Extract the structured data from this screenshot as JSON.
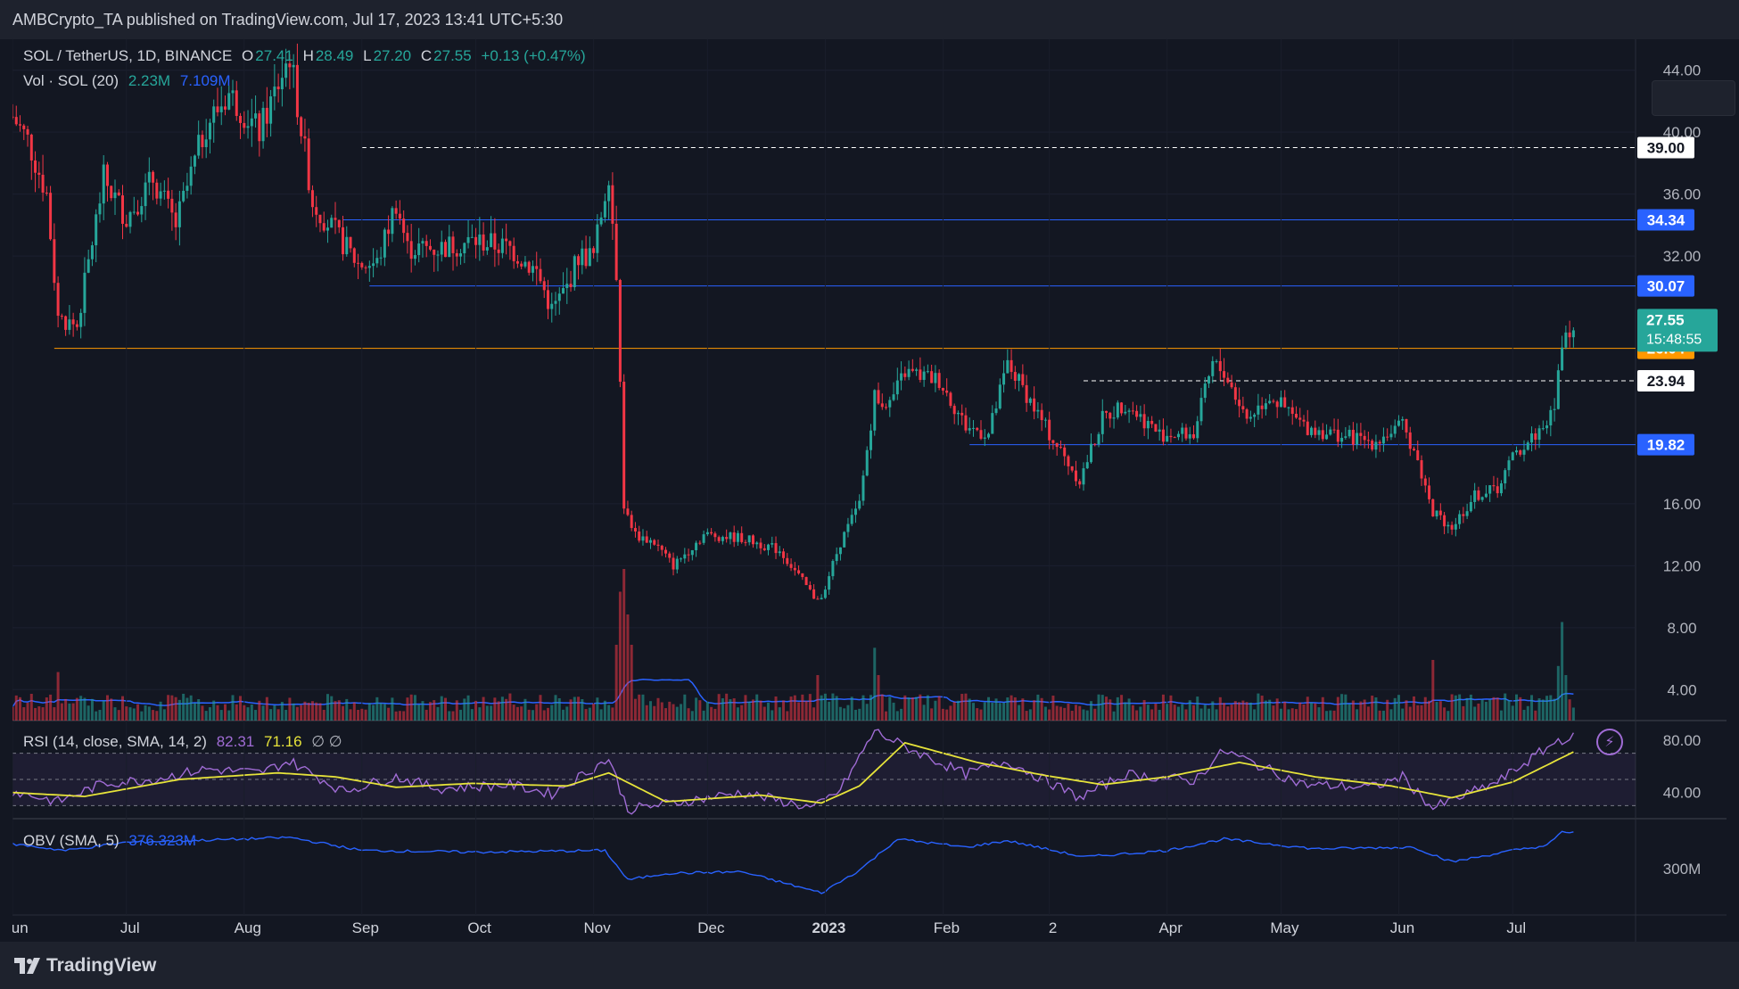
{
  "header": {
    "publisher": "AMBCrypto_TA published on TradingView.com, Jul 17, 2023 13:41 UTC+5:30"
  },
  "legend": {
    "symbol": "SOL / TetherUS, 1D, BINANCE",
    "o_key": "O",
    "o": "27.41",
    "h_key": "H",
    "h": "28.49",
    "l_key": "L",
    "l": "27.20",
    "c_key": "C",
    "c": "27.55",
    "change": "+0.13 (+0.47%)",
    "vol_label": "Vol · SOL (20)",
    "vol_value": "2.23M",
    "vol_ma": "7.109M",
    "rsi_label": "RSI (14, close, SMA, 14, 2)",
    "rsi_value": "82.31",
    "rsi_ma": "71.16",
    "rsi_extra": "∅ ∅",
    "obv_label": "OBV (SMA, 5)",
    "obv_value": "376.323M"
  },
  "footer": {
    "brand": "TradingView"
  },
  "colors": {
    "up": "#26a69a",
    "down": "#f23645",
    "blue": "#2962ff",
    "orange": "#ff9800",
    "rsi": "#a06cd5",
    "rsi_ma": "#e6e33a",
    "obv": "#2962ff",
    "bg": "#131722"
  },
  "chart_data": [
    {
      "type": "candlestick",
      "title": "SOL / TetherUS, 1D, BINANCE",
      "ylim": [
        2,
        46
      ],
      "y_ticks": [
        "4.00",
        "8.00",
        "12.00",
        "16.00",
        "32.00",
        "36.00",
        "40.00",
        "44.00"
      ],
      "x_ticks": [
        "Jun",
        "Jul",
        "Aug",
        "Sep",
        "Oct",
        "Nov",
        "Dec",
        "2023",
        "Feb",
        "2",
        "Apr",
        "May",
        "Jun",
        "Jul"
      ],
      "x_range": [
        "2022-06-01",
        "2023-07-31"
      ],
      "close_points": [
        [
          "2022-06-01",
          41.0
        ],
        [
          "2022-06-05",
          39.5
        ],
        [
          "2022-06-10",
          36.0
        ],
        [
          "2022-06-13",
          28.0
        ],
        [
          "2022-06-18",
          27.5
        ],
        [
          "2022-06-25",
          37.0
        ],
        [
          "2022-07-01",
          34.5
        ],
        [
          "2022-07-08",
          37.0
        ],
        [
          "2022-07-14",
          34.0
        ],
        [
          "2022-07-22",
          40.5
        ],
        [
          "2022-07-28",
          42.5
        ],
        [
          "2022-08-05",
          40.0
        ],
        [
          "2022-08-13",
          45.0
        ],
        [
          "2022-08-19",
          35.5
        ],
        [
          "2022-08-25",
          33.5
        ],
        [
          "2022-08-31",
          31.5
        ],
        [
          "2022-09-05",
          31.5
        ],
        [
          "2022-09-10",
          35.5
        ],
        [
          "2022-09-13",
          32.5
        ],
        [
          "2022-09-21",
          32.5
        ],
        [
          "2022-10-01",
          33.0
        ],
        [
          "2022-10-10",
          32.5
        ],
        [
          "2022-10-17",
          31.0
        ],
        [
          "2022-10-21",
          28.5
        ],
        [
          "2022-10-25",
          30.0
        ],
        [
          "2022-10-28",
          32.0
        ],
        [
          "2022-11-01",
          32.0
        ],
        [
          "2022-11-05",
          37.5
        ],
        [
          "2022-11-07",
          31.0
        ],
        [
          "2022-11-09",
          16.0
        ],
        [
          "2022-11-12",
          14.0
        ],
        [
          "2022-11-17",
          13.5
        ],
        [
          "2022-11-22",
          12.0
        ],
        [
          "2022-11-30",
          14.0
        ],
        [
          "2022-12-10",
          13.8
        ],
        [
          "2022-12-20",
          13.0
        ],
        [
          "2022-12-29",
          10.0
        ],
        [
          "2022-12-31",
          10.0
        ],
        [
          "2023-01-05",
          13.5
        ],
        [
          "2023-01-10",
          16.0
        ],
        [
          "2023-01-14",
          23.0
        ],
        [
          "2023-01-18",
          22.5
        ],
        [
          "2023-01-22",
          24.5
        ],
        [
          "2023-01-31",
          24.0
        ],
        [
          "2023-02-07",
          21.0
        ],
        [
          "2023-02-13",
          20.5
        ],
        [
          "2023-02-18",
          25.0
        ],
        [
          "2023-02-22",
          23.5
        ],
        [
          "2023-03-01",
          20.5
        ],
        [
          "2023-03-09",
          17.5
        ],
        [
          "2023-03-15",
          21.5
        ],
        [
          "2023-03-21",
          22.5
        ],
        [
          "2023-03-30",
          20.5
        ],
        [
          "2023-04-08",
          20.5
        ],
        [
          "2023-04-13",
          25.0
        ],
        [
          "2023-04-16",
          24.5
        ],
        [
          "2023-04-22",
          21.5
        ],
        [
          "2023-04-28",
          23.0
        ],
        [
          "2023-05-07",
          21.0
        ],
        [
          "2023-05-15",
          20.5
        ],
        [
          "2023-05-25",
          20.0
        ],
        [
          "2023-06-02",
          21.0
        ],
        [
          "2023-06-05",
          19.5
        ],
        [
          "2023-06-10",
          15.5
        ],
        [
          "2023-06-15",
          14.5
        ],
        [
          "2023-06-21",
          16.5
        ],
        [
          "2023-06-27",
          17.0
        ],
        [
          "2023-07-01",
          19.0
        ],
        [
          "2023-07-09",
          21.0
        ],
        [
          "2023-07-12",
          22.0
        ],
        [
          "2023-07-13",
          25.0
        ],
        [
          "2023-07-14",
          26.5
        ],
        [
          "2023-07-15",
          27.3
        ],
        [
          "2023-07-17",
          27.55
        ]
      ],
      "levels": [
        {
          "label": "39.00",
          "value": 39.0,
          "style": "dashed",
          "color": "#ffffff",
          "from": "2022-09-01"
        },
        {
          "label": "34.34",
          "value": 34.34,
          "style": "solid",
          "color": "#2962ff",
          "from": "2022-08-27"
        },
        {
          "label": "30.07",
          "value": 30.07,
          "style": "solid",
          "color": "#2962ff",
          "from": "2022-09-03"
        },
        {
          "label": "26.04",
          "value": 26.04,
          "style": "solid",
          "color": "#ff9800",
          "from": "2022-06-12"
        },
        {
          "label": "23.94",
          "value": 23.94,
          "style": "dashed",
          "color": "#ffffff",
          "from": "2023-03-10"
        },
        {
          "label": "19.82",
          "value": 19.82,
          "style": "solid",
          "color": "#2962ff",
          "from": "2023-02-08"
        }
      ],
      "last_price": {
        "value": 27.55,
        "label": "27.55",
        "countdown": "15:48:55"
      }
    },
    {
      "type": "bar",
      "title": "Vol · SOL (20)",
      "value": "2.23M",
      "ma": "7.109M",
      "spikes": [
        [
          "2022-06-13",
          3.2
        ],
        [
          "2022-11-07",
          5.0
        ],
        [
          "2022-11-08",
          8.5
        ],
        [
          "2022-11-09",
          10.0
        ],
        [
          "2022-11-10",
          7.0
        ],
        [
          "2022-11-11",
          5.0
        ],
        [
          "2022-12-30",
          3.0
        ],
        [
          "2023-01-14",
          4.8
        ],
        [
          "2023-01-15",
          3.0
        ],
        [
          "2023-06-10",
          4.0
        ],
        [
          "2023-07-13",
          3.6
        ],
        [
          "2023-07-14",
          6.5
        ],
        [
          "2023-07-15",
          3.0
        ]
      ]
    },
    {
      "type": "line",
      "title": "RSI (14, close, SMA, 14, 2)",
      "value": "82.31",
      "ma": "71.16",
      "ylim": [
        20,
        95
      ],
      "y_ticks": [
        "80.00",
        "40.00"
      ],
      "band": [
        30,
        70
      ],
      "points": [
        [
          "2022-06-01",
          41
        ],
        [
          "2022-06-13",
          33
        ],
        [
          "2022-06-25",
          47
        ],
        [
          "2022-07-08",
          50
        ],
        [
          "2022-07-22",
          58
        ],
        [
          "2022-08-05",
          55
        ],
        [
          "2022-08-13",
          64
        ],
        [
          "2022-08-27",
          41
        ],
        [
          "2022-09-10",
          52
        ],
        [
          "2022-09-21",
          43
        ],
        [
          "2022-10-10",
          46
        ],
        [
          "2022-10-21",
          39
        ],
        [
          "2022-11-05",
          66
        ],
        [
          "2022-11-10",
          27
        ],
        [
          "2022-11-22",
          32
        ],
        [
          "2022-12-10",
          40
        ],
        [
          "2022-12-29",
          28
        ],
        [
          "2023-01-05",
          42
        ],
        [
          "2023-01-14",
          87
        ],
        [
          "2023-01-22",
          75
        ],
        [
          "2023-02-07",
          54
        ],
        [
          "2023-02-18",
          64
        ],
        [
          "2023-03-09",
          36
        ],
        [
          "2023-03-21",
          54
        ],
        [
          "2023-04-08",
          49
        ],
        [
          "2023-04-16",
          72
        ],
        [
          "2023-05-07",
          46
        ],
        [
          "2023-05-25",
          44
        ],
        [
          "2023-06-02",
          52
        ],
        [
          "2023-06-10",
          28
        ],
        [
          "2023-06-27",
          48
        ],
        [
          "2023-07-05",
          64
        ],
        [
          "2023-07-13",
          80
        ],
        [
          "2023-07-17",
          82
        ]
      ],
      "ma_points": [
        [
          "2022-06-01",
          40
        ],
        [
          "2022-06-20",
          37
        ],
        [
          "2022-07-15",
          50
        ],
        [
          "2022-08-10",
          55
        ],
        [
          "2022-08-25",
          52
        ],
        [
          "2022-09-10",
          44
        ],
        [
          "2022-09-30",
          47
        ],
        [
          "2022-10-25",
          45
        ],
        [
          "2022-11-05",
          55
        ],
        [
          "2022-11-20",
          33
        ],
        [
          "2022-12-15",
          38
        ],
        [
          "2022-12-31",
          32
        ],
        [
          "2023-01-10",
          45
        ],
        [
          "2023-01-22",
          78
        ],
        [
          "2023-02-10",
          63
        ],
        [
          "2023-02-28",
          53
        ],
        [
          "2023-03-15",
          46
        ],
        [
          "2023-04-01",
          52
        ],
        [
          "2023-04-20",
          63
        ],
        [
          "2023-05-10",
          52
        ],
        [
          "2023-05-30",
          45
        ],
        [
          "2023-06-15",
          36
        ],
        [
          "2023-07-01",
          48
        ],
        [
          "2023-07-17",
          71
        ]
      ]
    },
    {
      "type": "line",
      "title": "OBV (SMA, 5)",
      "value": "376.323M",
      "y_ticks": [
        "300M"
      ],
      "ylim": [
        -30,
        390
      ],
      "points": [
        [
          "2022-06-01",
          340
        ],
        [
          "2022-06-15",
          320
        ],
        [
          "2022-07-01",
          345
        ],
        [
          "2022-08-01",
          355
        ],
        [
          "2022-08-13",
          360
        ],
        [
          "2022-09-01",
          320
        ],
        [
          "2022-10-01",
          315
        ],
        [
          "2022-11-04",
          320
        ],
        [
          "2022-11-10",
          230
        ],
        [
          "2022-11-20",
          250
        ],
        [
          "2022-12-10",
          255
        ],
        [
          "2022-12-31",
          190
        ],
        [
          "2023-01-10",
          260
        ],
        [
          "2023-01-20",
          355
        ],
        [
          "2023-02-07",
          330
        ],
        [
          "2023-02-18",
          350
        ],
        [
          "2023-03-10",
          300
        ],
        [
          "2023-04-01",
          320
        ],
        [
          "2023-04-16",
          355
        ],
        [
          "2023-05-10",
          325
        ],
        [
          "2023-06-05",
          330
        ],
        [
          "2023-06-15",
          285
        ],
        [
          "2023-07-01",
          320
        ],
        [
          "2023-07-10",
          335
        ],
        [
          "2023-07-14",
          376
        ],
        [
          "2023-07-17",
          376
        ]
      ]
    }
  ]
}
